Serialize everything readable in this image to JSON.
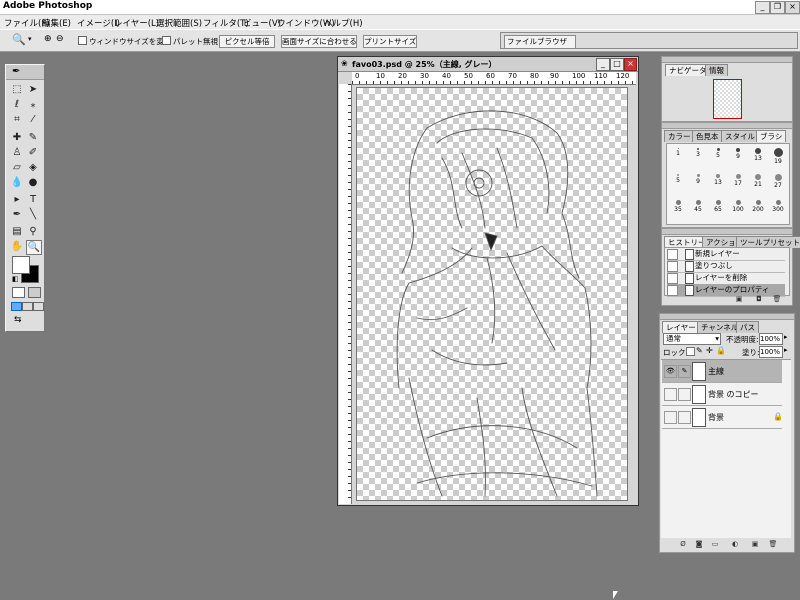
{
  "app": {
    "title": "Adobe Photoshop"
  },
  "menu": [
    "ファイル(F)",
    "編集(E)",
    "イメージ(I)",
    "レイヤー(L)",
    "選択範囲(S)",
    "フィルタ(T)",
    "ビュー(V)",
    "ウインドウ(W)",
    "ヘルプ(H)"
  ],
  "options": {
    "resize_windows": "ウィンドウサイズを変更",
    "ignore_palettes": "パレット無視",
    "btn_actual_pixels": "ピクセル等倍",
    "btn_fit_screen": "画面サイズに合わせる",
    "btn_print_size": "プリントサイズ",
    "file_browser_tab": "ファイルブラウザ"
  },
  "document": {
    "title": "favo03.psd @ 25%（主線, グレー）",
    "ruler_labels": [
      "0",
      "10",
      "20",
      "30",
      "40",
      "50",
      "60",
      "70",
      "80",
      "90",
      "100",
      "110",
      "120"
    ]
  },
  "navigator": {
    "tabs": [
      "ナビゲータ",
      "情報"
    ]
  },
  "brushes": {
    "tabs": [
      "カラー",
      "色見本",
      "スタイル",
      "ブラシ"
    ],
    "sizes": [
      [
        "1",
        "3",
        "5",
        "9",
        "13",
        "19"
      ],
      [
        "5",
        "9",
        "13",
        "17",
        "21",
        "27"
      ],
      [
        "35",
        "45",
        "65",
        "100",
        "200",
        "300"
      ]
    ]
  },
  "history": {
    "tabs": [
      "ヒストリー",
      "アクション",
      "ツールプリセット"
    ],
    "items": [
      "新規レイヤー",
      "塗りつぶし",
      "レイヤーを削除",
      "レイヤーのプロパティ"
    ]
  },
  "layers": {
    "tabs": [
      "レイヤー",
      "チャンネル",
      "パス"
    ],
    "blend_mode": "通常",
    "opacity_label": "不透明度:",
    "opacity_value": "100%",
    "lock_label": "ロック:",
    "fill_label": "塗り:",
    "fill_value": "100%",
    "items": [
      "主線",
      "背景 のコピー",
      "背景"
    ]
  }
}
